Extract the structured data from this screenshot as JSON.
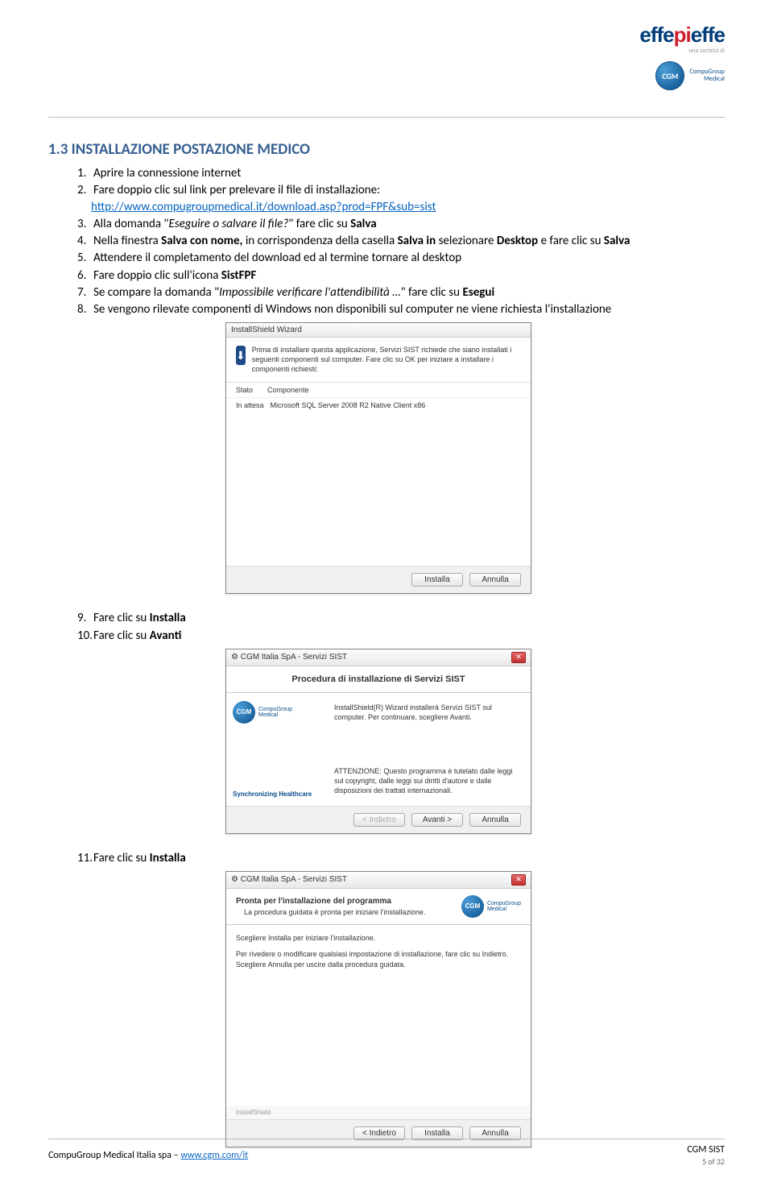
{
  "logo": {
    "efe": "effe",
    "pi": "pi",
    "effe2": "effe",
    "sub": "una società di"
  },
  "cgm": {
    "orb": "CGM",
    "line1": "CompuGroup",
    "line2": "Medical"
  },
  "section": {
    "title": "1.3 INSTALLAZIONE POSTAZIONE MEDICO",
    "items": {
      "n1": "1.",
      "t1": "Aprire la connessione internet",
      "n2": "2.",
      "t2a": "Fare doppio clic sul link per prelevare il file di installazione:",
      "link": "http://www.compugroupmedical.it/download.asp?prod=FPF&sub=sist",
      "n3": "3.",
      "t3a": "Alla domanda \"",
      "t3b": "Eseguire o salvare il file?",
      "t3c": "\" fare clic su ",
      "t3d": "Salva",
      "n4": "4.",
      "t4a": "Nella finestra ",
      "t4b": "Salva con nome,",
      "t4c": " in corrispondenza della casella ",
      "t4d": "Salva in",
      "t4e": " selezionare ",
      "t4f": "Desktop",
      "t4g": " e fare clic su ",
      "t4h": "Salva",
      "n5": "5.",
      "t5": "Attendere il completamento del download ed al termine tornare al desktop",
      "n6": "6.",
      "t6a": "Fare doppio clic sull'icona ",
      "t6b": "SistFPF",
      "n7": "7.",
      "t7a": "Se compare la domanda \"",
      "t7b": "Impossibile verificare l'attendibilità …",
      "t7c": "\" fare clic su ",
      "t7d": "Esegui",
      "n8": "8.",
      "t8": "Se vengono rilevate componenti di Windows non disponibili sul computer ne viene richiesta l'installazione",
      "n9": "9.",
      "t9a": "Fare clic su ",
      "t9b": "Installa",
      "n10": "10.",
      "t10a": "Fare clic su ",
      "t10b": "Avanti",
      "n11": "11.",
      "t11a": "Fare clic su ",
      "t11b": "Installa"
    }
  },
  "dialog1": {
    "title": "InstallShield Wizard",
    "msg": "Prima di installare questa applicazione, Servizi SIST richiede che siano installati i seguenti componenti sul computer. Fare clic su OK per iniziare a installare i componenti richiesti:",
    "col1": "Stato",
    "col2": "Componente",
    "row_s": "In attesa",
    "row_c": "Microsoft SQL Server 2008 R2 Native Client x86",
    "btn_install": "Installa",
    "btn_cancel": "Annulla"
  },
  "dialog2": {
    "tb_title": "CGM Italia SpA - Servizi SIST",
    "banner": "Procedura di installazione di Servizi SIST",
    "body1": "InstallShield(R) Wizard installerà Servizi SIST sul computer. Per continuare, scegliere Avanti.",
    "body2": "ATTENZIONE: Questo programma è tutelato dalle leggi sul copyright, dalle leggi sui diritti d'autore e dalle disposizioni dei trattati internazionali.",
    "sync": "Synchronizing Healthcare",
    "btn_back": "< Indietro",
    "btn_next": "Avanti >",
    "btn_cancel": "Annulla"
  },
  "dialog3": {
    "tb_title": "CGM Italia SpA - Servizi SIST",
    "head": "Pronta per l'installazione del programma",
    "sub": "La procedura guidata è pronta per iniziare l'installazione.",
    "p1": "Scegliere Installa per iniziare l'installazione.",
    "p2": "Per rivedere o modificare qualsiasi impostazione di installazione, fare clic su Indietro. Scegliere Annulla per uscire dalla procedura guidata.",
    "ishield": "InstallShield",
    "btn_back": "< Indietro",
    "btn_install": "Installa",
    "btn_cancel": "Annulla"
  },
  "footer": {
    "left_a": "CompuGroup Medical Italia spa – ",
    "left_link": "www.cgm.com/it",
    "right": "CGM SIST",
    "page": "5 of 32"
  }
}
